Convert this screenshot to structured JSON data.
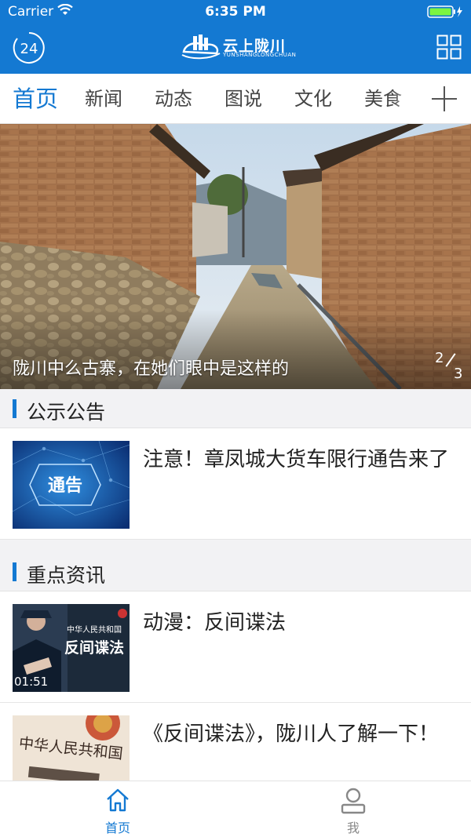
{
  "status_bar": {
    "carrier": "Carrier",
    "time": "6:35 PM"
  },
  "header": {
    "badge": "24",
    "logo_text": "云上陇川",
    "logo_sub": "YUNSHANGLONGCHUAN"
  },
  "tabs": [
    {
      "label": "首页",
      "active": true
    },
    {
      "label": "新闻"
    },
    {
      "label": "动态"
    },
    {
      "label": "图说"
    },
    {
      "label": "文化"
    },
    {
      "label": "美食"
    }
  ],
  "banner": {
    "caption": "陇川中么古寨，在她们眼中是这样的",
    "page_current": "2",
    "page_total": "3"
  },
  "sections": {
    "notices": {
      "title": "公示公告",
      "items": [
        {
          "title": "注意！章凤城大货车限行通告来了",
          "thumb_text": "通告"
        }
      ]
    },
    "key_news": {
      "title": "重点资讯",
      "items": [
        {
          "title": "动漫：反间谍法",
          "duration": "01:51",
          "thumb_text": "反间谍法",
          "thumb_caption": "中华人民共和国"
        },
        {
          "title": "《反间谍法》，陇川人了解一下！",
          "thumb_text": "中华人民共和国"
        }
      ]
    }
  },
  "tabbar": [
    {
      "label": "首页",
      "icon": "home-icon",
      "active": true
    },
    {
      "label": "我",
      "icon": "profile-icon"
    }
  ],
  "colors": {
    "brand": "#1479d2",
    "text": "#222222"
  }
}
